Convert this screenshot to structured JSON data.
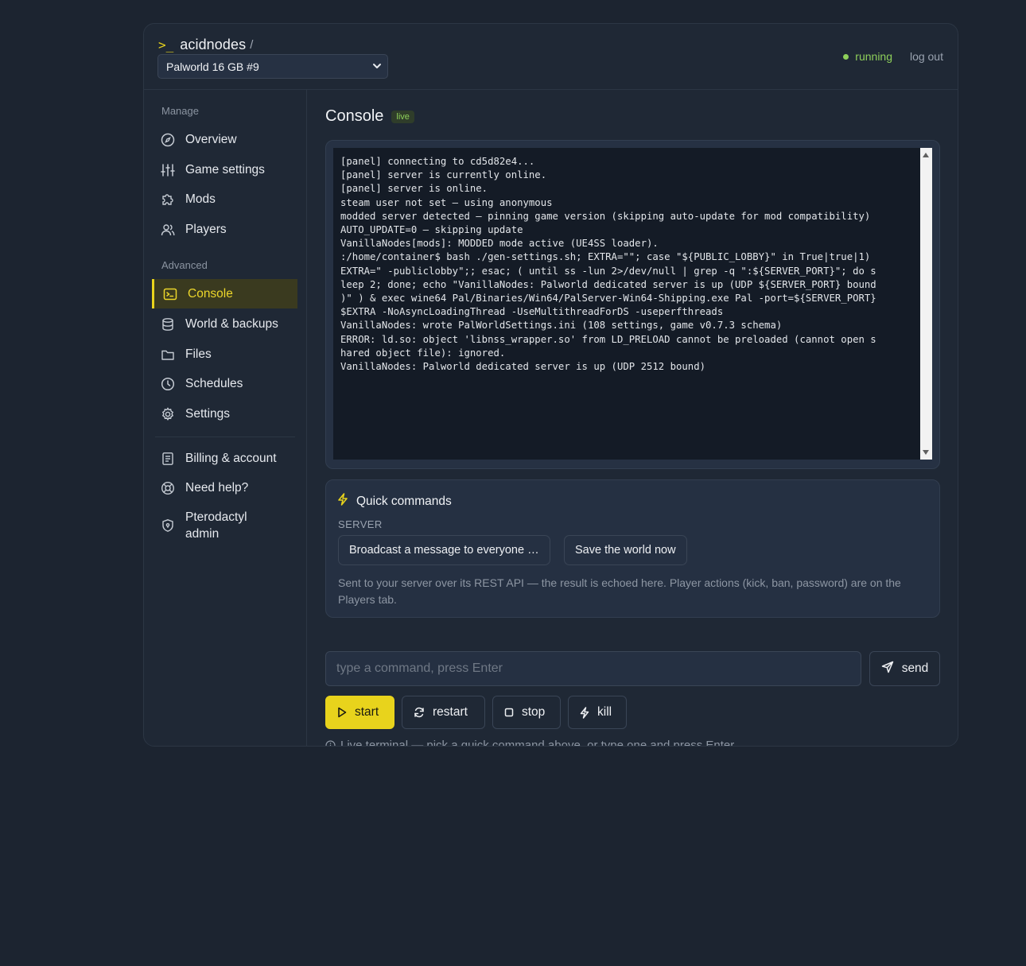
{
  "header": {
    "brand_prompt": ">_",
    "brand_name": "acidnodes",
    "brand_sep": "/",
    "server_selected": "Palworld 16 GB #9",
    "status": "running",
    "logout": "log out"
  },
  "sidebar": {
    "manage_label": "Manage",
    "advanced_label": "Advanced",
    "manage_items": [
      {
        "label": "Overview",
        "icon": "gauge-icon"
      },
      {
        "label": "Game settings",
        "icon": "sliders-icon"
      },
      {
        "label": "Mods",
        "icon": "puzzle-icon"
      },
      {
        "label": "Players",
        "icon": "users-icon"
      }
    ],
    "advanced_items": [
      {
        "label": "Console",
        "icon": "terminal-icon",
        "active": true
      },
      {
        "label": "World & backups",
        "icon": "database-icon"
      },
      {
        "label": "Files",
        "icon": "folder-icon"
      },
      {
        "label": "Schedules",
        "icon": "clock-icon"
      },
      {
        "label": "Settings",
        "icon": "gear-icon"
      }
    ],
    "account_items": [
      {
        "label": "Billing & account",
        "icon": "receipt-icon"
      },
      {
        "label": "Need help?",
        "icon": "lifebuoy-icon"
      },
      {
        "label": "Pterodactyl admin",
        "icon": "shield-icon"
      }
    ]
  },
  "main": {
    "title": "Console",
    "badge": "live",
    "console_lines": [
      "[panel] connecting to cd5d82e4...",
      "[panel] server is currently online.",
      "[panel] server is online.",
      "steam user not set — using anonymous",
      "modded server detected — pinning game version (skipping auto-update for mod compatibility)",
      "AUTO_UPDATE=0 — skipping update",
      "VanillaNodes[mods]: MODDED mode active (UE4SS loader).",
      ":/home/container$ bash ./gen-settings.sh; EXTRA=\"\"; case \"${PUBLIC_LOBBY}\" in True|true|1)",
      "EXTRA=\" -publiclobby\";; esac; ( until ss -lun 2>/dev/null | grep -q \":${SERVER_PORT}\"; do s",
      "leep 2; done; echo \"VanillaNodes: Palworld dedicated server is up (UDP ${SERVER_PORT} bound",
      ")\" ) & exec wine64 Pal/Binaries/Win64/PalServer-Win64-Shipping.exe Pal -port=${SERVER_PORT}",
      "$EXTRA -NoAsyncLoadingThread -UseMultithreadForDS -useperfthreads",
      "VanillaNodes: wrote PalWorldSettings.ini (108 settings, game v0.7.3 schema)",
      "ERROR: ld.so: object 'libnss_wrapper.so' from LD_PRELOAD cannot be preloaded (cannot open s",
      "hared object file): ignored.",
      "VanillaNodes: Palworld dedicated server is up (UDP 2512 bound)"
    ],
    "quick": {
      "title": "Quick commands",
      "section": "SERVER",
      "buttons": [
        "Broadcast a message to everyone …",
        "Save the world now"
      ],
      "note": "Sent to your server over its REST API — the result is echoed here. Player actions (kick, ban, password) are on the Players tab."
    },
    "command": {
      "placeholder": "type a command, press Enter",
      "send": "send"
    },
    "power": {
      "start": "start",
      "restart": "restart",
      "stop": "stop",
      "kill": "kill"
    },
    "hint": "Live terminal — pick a quick command above, or type one and press Enter."
  },
  "colors": {
    "accent": "#e8d31c",
    "running": "#8ecf5a",
    "background": "#1c2430",
    "console_bg": "#141b26"
  }
}
